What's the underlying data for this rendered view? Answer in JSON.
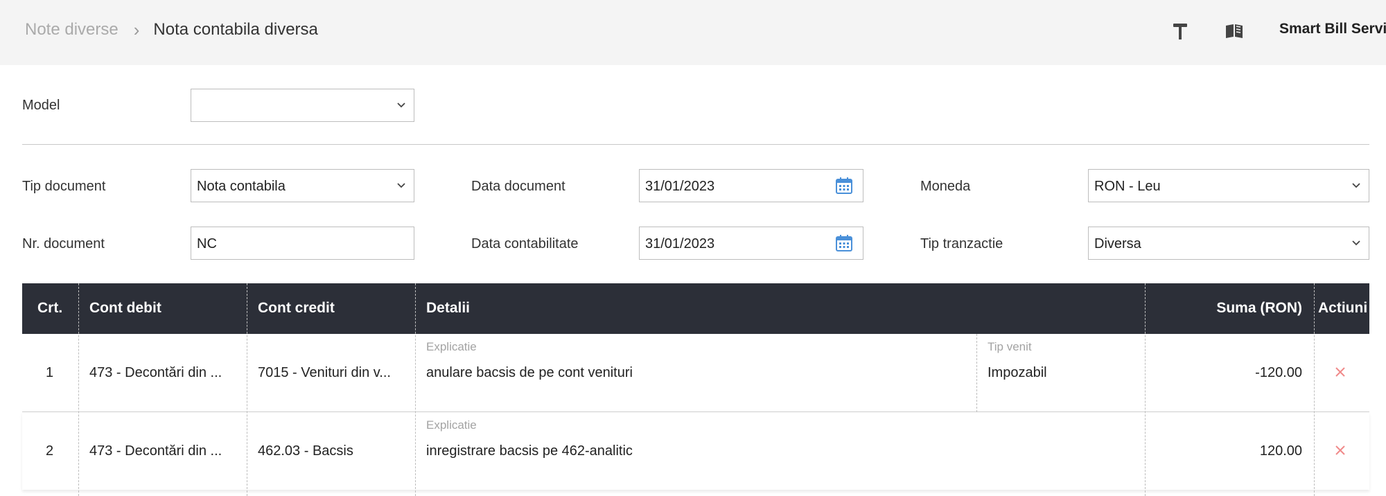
{
  "breadcrumb": {
    "parent": "Note diverse",
    "separator": "›",
    "current": "Nota contabila diversa"
  },
  "header": {
    "icons": [
      "hammer-icon",
      "book-icon"
    ],
    "company": "Smart Bill Servic"
  },
  "form": {
    "model": {
      "label": "Model",
      "value": ""
    },
    "tip_document": {
      "label": "Tip document",
      "value": "Nota contabila"
    },
    "nr_document": {
      "label": "Nr. document",
      "value": "NC"
    },
    "data_document": {
      "label": "Data document",
      "value": "31/01/2023"
    },
    "data_contabilitate": {
      "label": "Data contabilitate",
      "value": "31/01/2023"
    },
    "moneda": {
      "label": "Moneda",
      "value": "RON - Leu"
    },
    "tip_tranzactie": {
      "label": "Tip tranzactie",
      "value": "Diversa"
    }
  },
  "table": {
    "columns": [
      "Crt.",
      "Cont debit",
      "Cont credit",
      "Detalii",
      "Suma (RON)",
      "Actiuni"
    ],
    "sub_labels": {
      "explicatie": "Explicatie",
      "tip_venit": "Tip venit"
    },
    "rows": [
      {
        "crt": "1",
        "cont_debit": "473 - Decontări din ...",
        "cont_credit": "7015 - Venituri din v...",
        "explicatie": "anulare bacsis de pe cont venituri",
        "tip_venit": "Impozabil",
        "suma": "-120.00"
      },
      {
        "crt": "2",
        "cont_debit": "473 - Decontări din ...",
        "cont_credit": "462.03 - Bacsis",
        "explicatie": "inregistrare bacsis pe 462-analitic",
        "suma": "120.00"
      }
    ]
  },
  "colors": {
    "header_bg": "#2c2f38",
    "topbar_bg": "#f4f4f4",
    "calendar_accent": "#4a90d9",
    "delete_accent": "#f08a8a"
  }
}
